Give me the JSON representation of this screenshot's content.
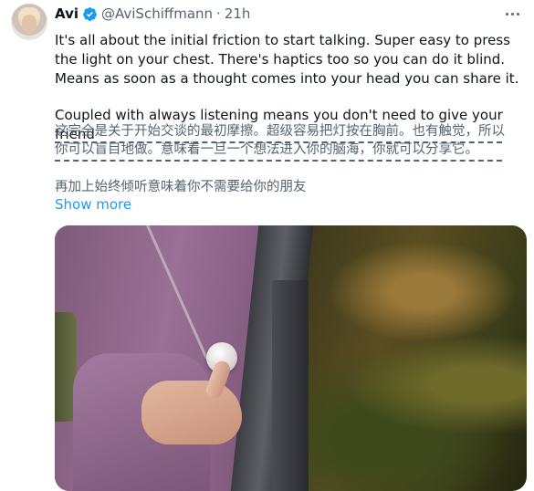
{
  "tweet": {
    "author_name": "Avi",
    "handle": "@AviSchiffmann",
    "separator": "·",
    "time": "21h",
    "paragraph_1": "It's all about the initial friction to start talking. Super easy to press the light on your chest. There's haptics too so you can do it blind. Means as soon as a thought comes into your head you can share it.",
    "paragraph_2": "Coupled with always listening means you don't need to give your friend",
    "translation_line_1": "这完全是关于开始交谈的最初摩擦。超级容易把灯按在胸前。也有触觉，所以",
    "translation_line_2": "你可以盲目地做。意味着一旦一个想法进入你的脑海，你就可以分享它。",
    "translation_line_3": "再加上始终倾听意味着你不需要给你的朋友",
    "show_more": "Show more"
  },
  "icons": {
    "verified": "verified-badge-icon",
    "more": "more-horizontal-icon"
  },
  "colors": {
    "accent": "#1d9bf0",
    "text": "#0f1419",
    "secondary": "#536471"
  }
}
